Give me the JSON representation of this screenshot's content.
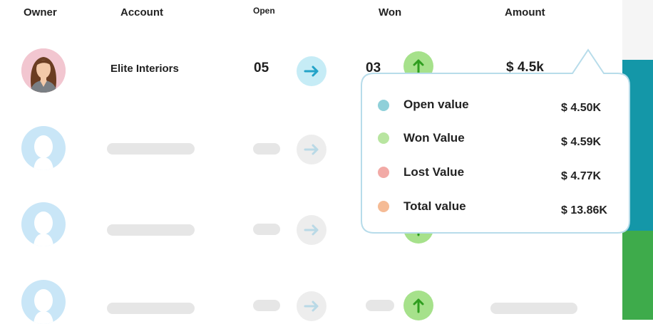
{
  "headers": {
    "owner": "Owner",
    "account": "Account",
    "open": "Open",
    "won": "Won",
    "amount": "Amount"
  },
  "row1": {
    "account": "Elite Interiors",
    "open": "05",
    "won": "03",
    "amount": "$ 4.5k"
  },
  "tooltip": {
    "items": [
      {
        "label": "Open value",
        "value": "$ 4.50K",
        "color": "#8fd0d9"
      },
      {
        "label": "Won Value",
        "value": "$ 4.59K",
        "color": "#b8e5a0"
      },
      {
        "label": "Lost Value",
        "value": "$ 4.77K",
        "color": "#f2aaa6"
      },
      {
        "label": "Total value",
        "value": "$ 13.86K",
        "color": "#f5bb95"
      }
    ]
  },
  "icons": {
    "open_arrow": "arrow-right-icon",
    "won_arrow": "arrow-up-icon",
    "avatar_placeholder": "user-placeholder-icon"
  },
  "colors": {
    "accent_teal": "#1497a8",
    "accent_green": "#3eab4b",
    "won_icon": "#2f9e1f",
    "open_icon": "#23a3c8"
  }
}
